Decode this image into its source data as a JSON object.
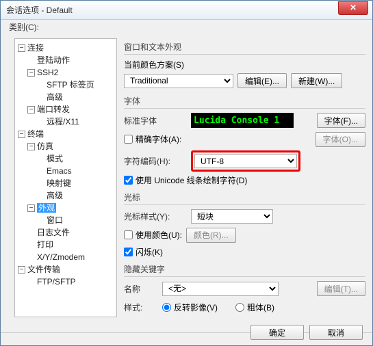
{
  "window": {
    "title": "会话选项 - Default"
  },
  "category_label": "类别(C):",
  "tree": {
    "connection": "连接",
    "login_action": "登陆动作",
    "ssh2": "SSH2",
    "sftp_tabs": "SFTP 标签页",
    "advanced1": "高级",
    "port_forward": "端口转发",
    "remote_x11": "远程/X11",
    "terminal": "终端",
    "emulation": "仿真",
    "mode": "模式",
    "emacs": "Emacs",
    "mapping_keys": "映射键",
    "advanced2": "高级",
    "appearance": "外观",
    "window_item": "窗口",
    "log_file": "日志文件",
    "print": "打印",
    "xyzmodem": "X/Y/Zmodem",
    "file_transfer": "文件传输",
    "ftp_sftp": "FTP/SFTP"
  },
  "panel": {
    "heading": "窗口和文本外观",
    "scheme_label": "当前颜色方案(S)",
    "scheme_value": "Traditional",
    "edit_btn": "编辑(E)...",
    "new_btn": "新建(W)...",
    "font_group": "字体",
    "std_font_label": "标准字体",
    "font_preview": "Lucida Console 1",
    "font_btn": "字体(F)...",
    "precise_font_chk": "精确字体(A):",
    "font_o_btn": "字体(O)...",
    "charset_label": "字符编码(H):",
    "charset_value": "UTF-8",
    "unicode_chk": "使用 Unicode 线条绘制字符(D)",
    "cursor_group": "光标",
    "cursor_style_label": "光标样式(Y):",
    "cursor_style_value": "短块",
    "use_color_chk": "使用颜色(U):",
    "color_btn": "颜色(R)...",
    "blink_chk": "闪烁(K)",
    "keywords_group": "隐藏关键字",
    "name_label": "名称",
    "name_value": "<无>",
    "edit_t_btn": "编辑(T)...",
    "style_label": "样式:",
    "style_reverse": "反转影像(V)",
    "style_bold": "粗体(B)"
  },
  "footer": {
    "ok": "确定",
    "cancel": "取消"
  }
}
